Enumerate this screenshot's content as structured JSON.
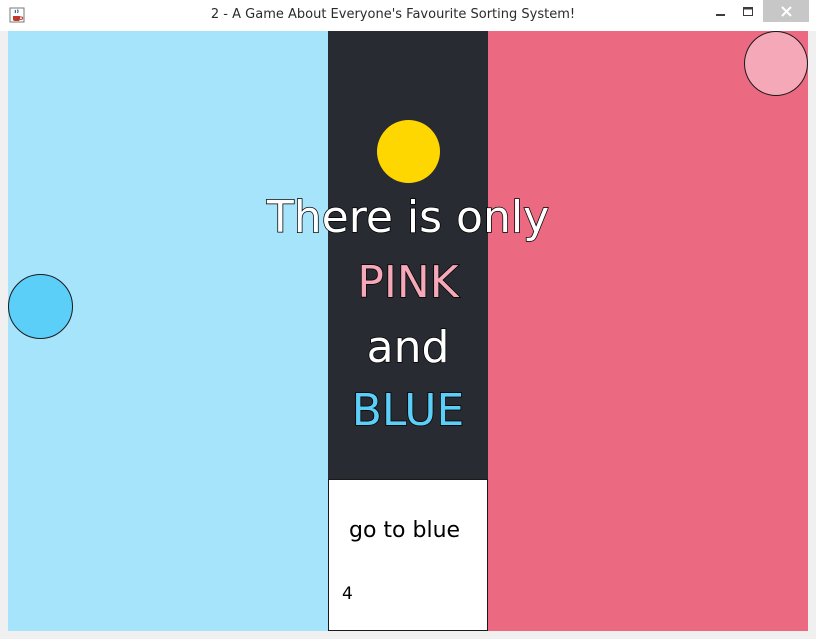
{
  "window": {
    "title": "2 - A Game About Everyone's Favourite Sorting System!",
    "app_icon": "java-coffee-cup-icon",
    "controls": [
      "minimize-icon",
      "maximize-icon",
      "close-icon"
    ]
  },
  "game": {
    "zones": {
      "blue": "#a6e4fb",
      "center": "#282b31",
      "pink": "#ec6a81"
    },
    "balls": {
      "yellow": "#ffd700",
      "blue": "#5ccff9",
      "pink": "#f5a8b8"
    },
    "message": {
      "line1": "There is only",
      "line2": "PINK",
      "line3": "and",
      "line4": "BLUE",
      "pink_color": "#f5a8b8",
      "blue_color": "#5ccff9"
    },
    "panel": {
      "instruction": "go to blue",
      "counter": "4"
    }
  }
}
